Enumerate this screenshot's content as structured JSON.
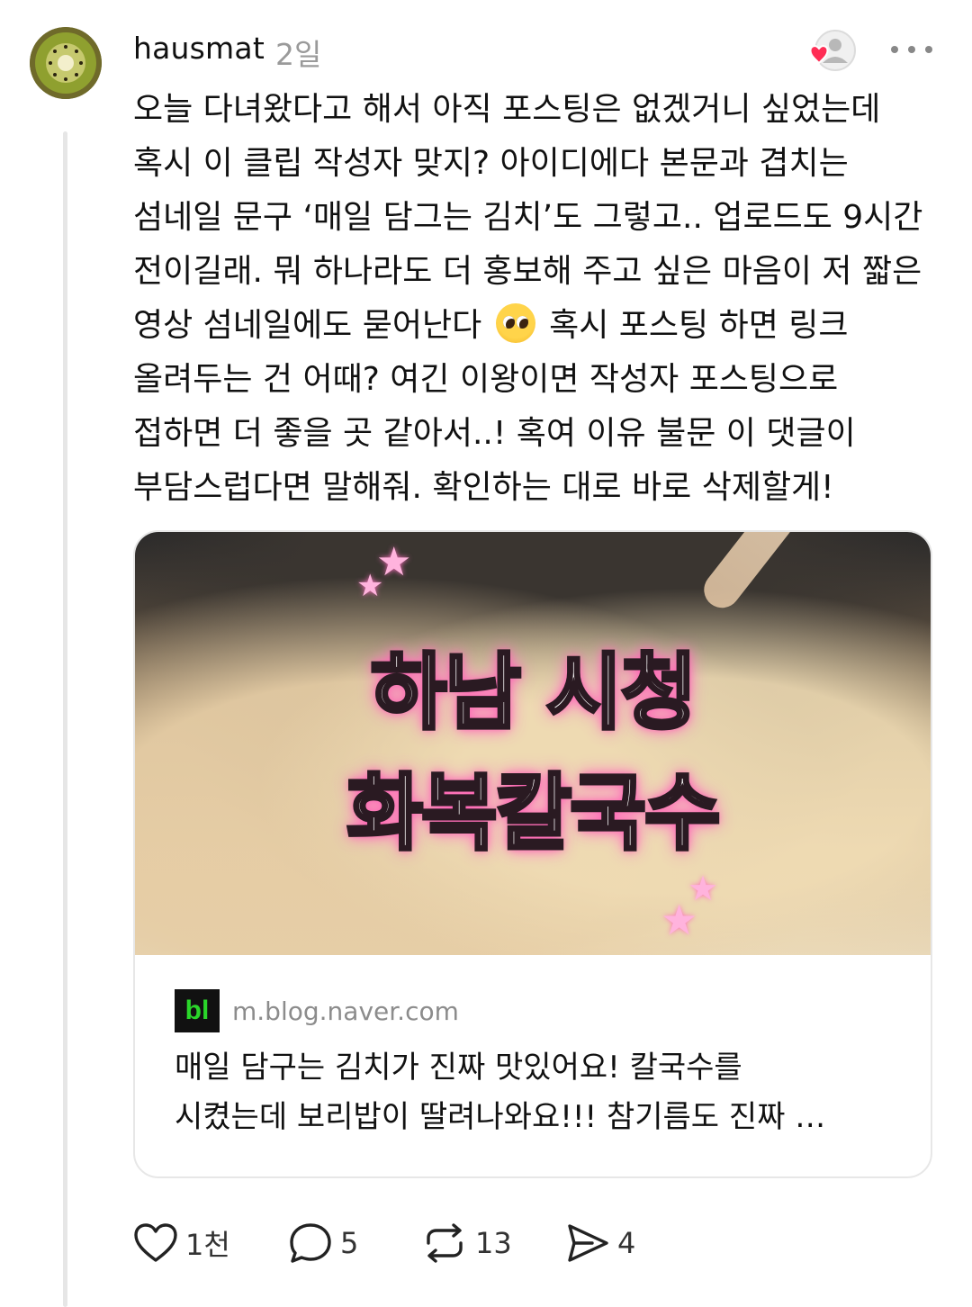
{
  "post": {
    "username": "hausmat",
    "timestamp": "2일",
    "text_lines": [
      "오늘 다녀왔다고 해서 아직 포스팅은 없겠거니 싶었는데",
      "혹시 이 클립 작성자 맞지? 아이디에다 본문과 겹치는",
      "섬네일 문구 ‘매일 담그는 김치’도 그렇고.. 업로드도 9시간",
      "전이길래. 뭐 하나라도 더 홍보해 주고 싶은 마음이 저 짧은",
      "영상 섬네일에도 묻어난다",
      "혹시 포스팅 하면 링크",
      "올려두는 건 어때? 여긴 이왕이면 작성자 포스팅으로",
      "접하면 더 좋을 곳 같아서..! 혹여 이유 불문 이 댓글이",
      "부담스럽다면 말해줘. 확인하는 대로 바로 삭제할게!"
    ],
    "emoji": "pleading-face-emoji"
  },
  "link_card": {
    "thumbnail_text_line1": "하남 시청",
    "thumbnail_text_line2": "화복칼국수",
    "site_logo": "bl",
    "domain": "m.blog.naver.com",
    "description_lines": [
      "매일 담구는 김치가 진짜 맛있어요! 칼국수를",
      "시켰는데 보리밥이 딸려나와요!!! 참기름도 진짜 …"
    ]
  },
  "actions": {
    "like_count": "1천",
    "reply_count": "5",
    "repost_count": "13",
    "share_count": "4"
  },
  "colors": {
    "accent_heart": "#ff2d55",
    "muted_text": "#9a9a9a",
    "naver_green": "#2ad62a"
  }
}
